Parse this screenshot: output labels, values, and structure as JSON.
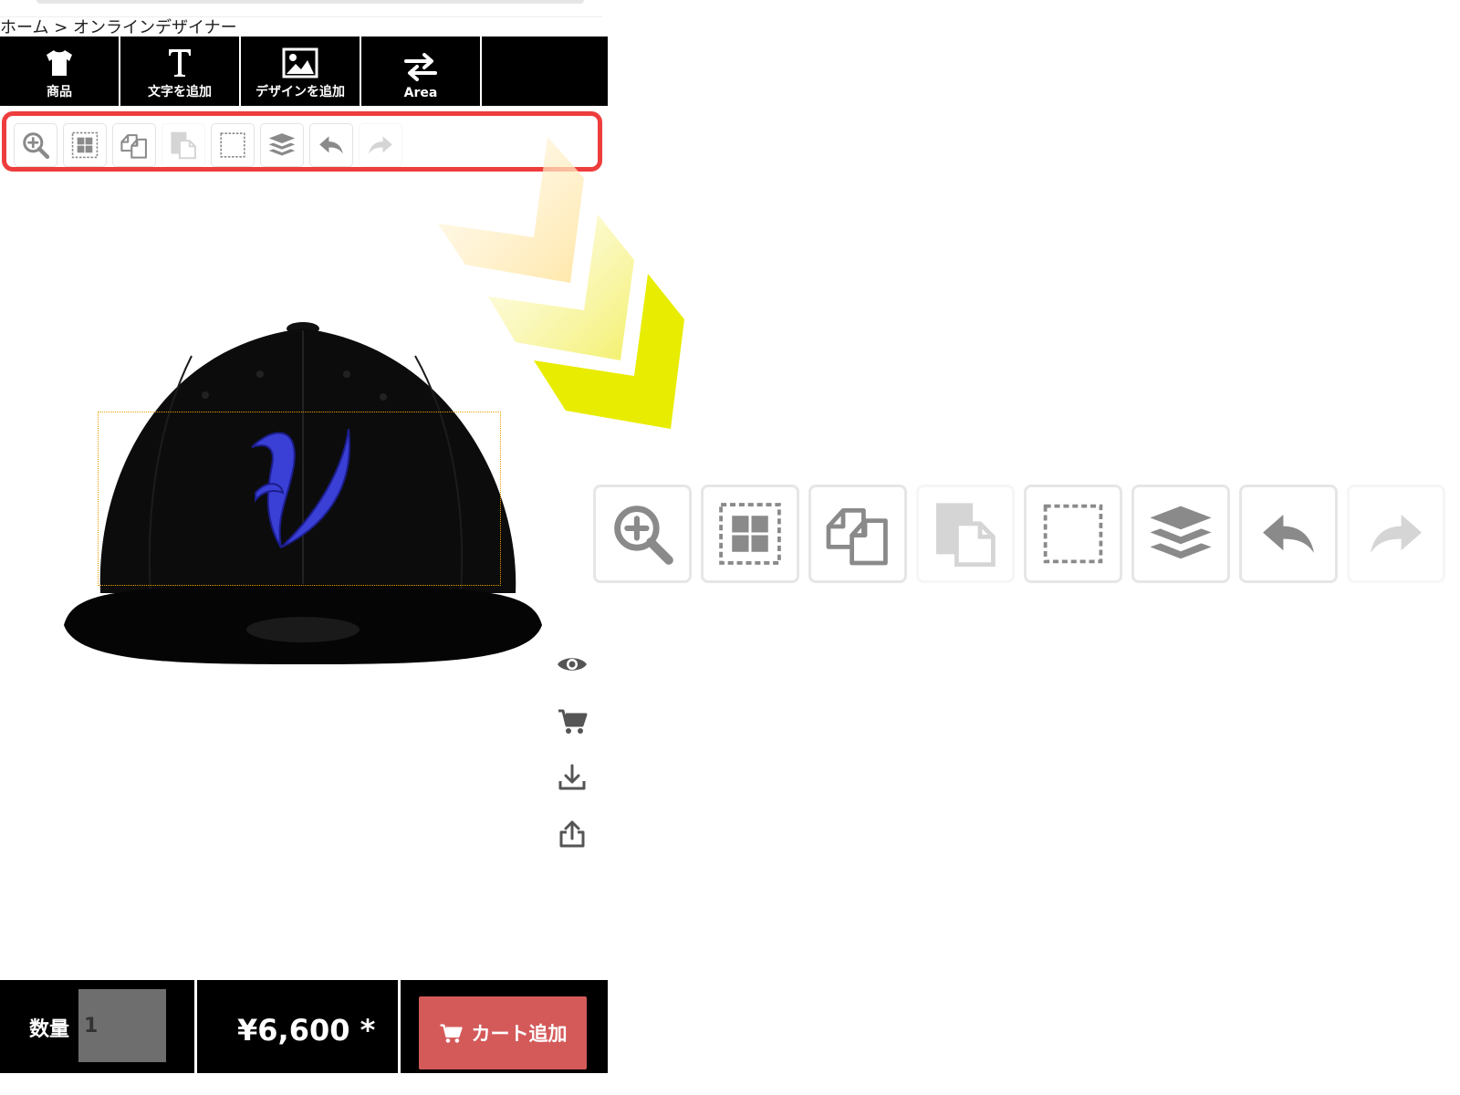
{
  "breadcrumb": {
    "home": "ホーム",
    "separator": ">",
    "current": "オンラインデザイナー"
  },
  "main_toolbar": {
    "items": [
      {
        "label": "商品",
        "icon": "tshirt-icon"
      },
      {
        "label": "文字を追加",
        "icon": "text-icon"
      },
      {
        "label": "デザインを追加",
        "icon": "image-icon"
      },
      {
        "label": "Area",
        "icon": "swap-arrows-icon"
      }
    ]
  },
  "sub_toolbar": {
    "items": [
      {
        "icon": "zoom-in-icon",
        "enabled": true
      },
      {
        "icon": "grid-select-icon",
        "enabled": true
      },
      {
        "icon": "duplicate-icon",
        "enabled": true
      },
      {
        "icon": "paste-icon",
        "enabled": false
      },
      {
        "icon": "deselect-icon",
        "enabled": true
      },
      {
        "icon": "layers-icon",
        "enabled": true
      },
      {
        "icon": "undo-icon",
        "enabled": true
      },
      {
        "icon": "redo-icon",
        "enabled": false
      }
    ],
    "highlight_color": "#ee3d3d"
  },
  "side_actions": [
    {
      "icon": "preview-eye-icon"
    },
    {
      "icon": "cart-icon"
    },
    {
      "icon": "download-icon"
    },
    {
      "icon": "share-icon"
    }
  ],
  "bottom_bar": {
    "quantity_label": "数量",
    "quantity_value": "1",
    "price": "¥6,600 *",
    "add_to_cart_label": "カート追加"
  },
  "colors": {
    "toolbar_bg": "#000000",
    "cart_button": "#d45a5a",
    "logo_blue": "#3a3fd6",
    "print_area_border": "#e8a000",
    "chevron_yellow": "#e8ec00"
  }
}
